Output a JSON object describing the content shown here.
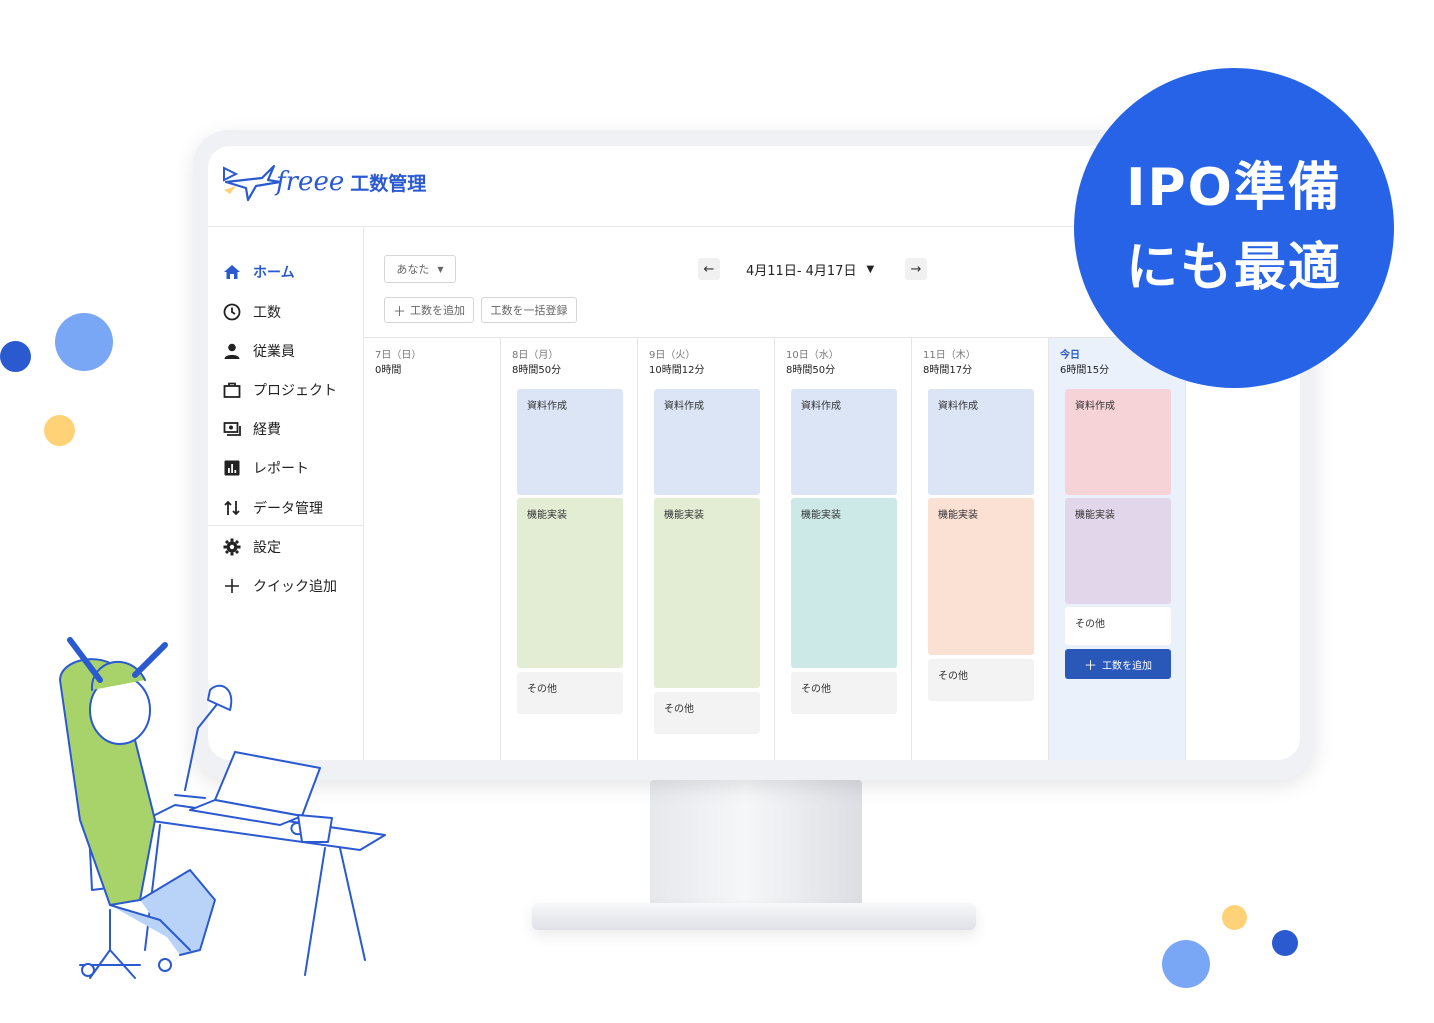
{
  "header": {
    "brand": "freee",
    "product": "工数管理"
  },
  "sidebar": {
    "items": [
      {
        "label": "ホーム",
        "icon": "home-icon",
        "active": true
      },
      {
        "label": "工数",
        "icon": "clock-icon"
      },
      {
        "label": "従業員",
        "icon": "person-icon"
      },
      {
        "label": "プロジェクト",
        "icon": "briefcase-icon"
      },
      {
        "label": "経費",
        "icon": "money-icon"
      },
      {
        "label": "レポート",
        "icon": "chart-icon"
      },
      {
        "label": "データ管理",
        "icon": "transfer-icon"
      },
      {
        "label": "設定",
        "icon": "gear-icon"
      },
      {
        "label": "クイック追加",
        "icon": "plus-icon"
      }
    ]
  },
  "toolbar": {
    "user_select": "あなた",
    "add_label": "工数を追加",
    "bulk_label": "工数を一括登録",
    "date_range": "4月11日- 4月17日"
  },
  "days": [
    {
      "date": "7日（日）",
      "hours": "0時間",
      "blocks": []
    },
    {
      "date": "8日（月）",
      "hours": "8時間50分",
      "blocks": [
        {
          "label": "資料作成",
          "color": "#dbe5f6"
        },
        {
          "label": "機能実装",
          "color": "#e3edd4"
        },
        {
          "label": "その他",
          "color": "#f3f3f3"
        }
      ]
    },
    {
      "date": "9日（火）",
      "hours": "10時間12分",
      "blocks": [
        {
          "label": "資料作成",
          "color": "#dbe5f6"
        },
        {
          "label": "機能実装",
          "color": "#e3edd4"
        },
        {
          "label": "その他",
          "color": "#f3f3f3"
        }
      ]
    },
    {
      "date": "10日（水）",
      "hours": "8時間50分",
      "blocks": [
        {
          "label": "資料作成",
          "color": "#dbe5f6"
        },
        {
          "label": "機能実装",
          "color": "#cce9e8"
        },
        {
          "label": "その他",
          "color": "#f3f3f3"
        }
      ]
    },
    {
      "date": "11日（木）",
      "hours": "8時間17分",
      "blocks": [
        {
          "label": "資料作成",
          "color": "#dbe5f6"
        },
        {
          "label": "機能実装",
          "color": "#fbe0d4"
        },
        {
          "label": "その他",
          "color": "#f3f3f3"
        }
      ]
    },
    {
      "date": "今日",
      "hours": "6時間15分",
      "blocks": [
        {
          "label": "資料作成",
          "color": "#f5d3d7"
        },
        {
          "label": "機能実装",
          "color": "#e2d7ea"
        },
        {
          "label": "その他",
          "color": "#ffffff"
        }
      ],
      "add_label": "工数を追加"
    }
  ],
  "badge": {
    "line1": "IPO準備",
    "line2": "にも最適"
  },
  "colors": {
    "brand": "#2a59d0",
    "badge": "#2763e6",
    "today_bg": "#eaf1fb",
    "add_button": "#2958b8"
  }
}
